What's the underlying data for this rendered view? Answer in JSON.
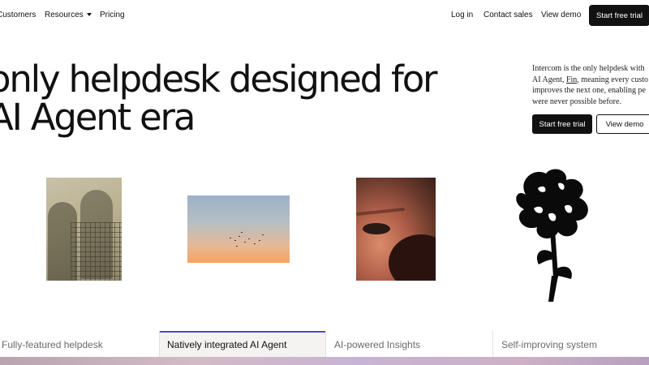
{
  "nav": {
    "customers": "Customers",
    "resources": "Resources",
    "pricing": "Pricing",
    "login": "Log in",
    "contact_sales": "Contact sales",
    "view_demo": "View demo",
    "start_trial": "Start free trial"
  },
  "hero": {
    "line1": "only helpdesk designed for",
    "line2": "AI Agent era",
    "desc_line1": "Intercom is the only helpdesk with",
    "desc_line2a": "AI Agent,",
    "desc_link": "Fin",
    "desc_line2b": ", meaning every custo",
    "desc_line3": "improves the next one, enabling pe",
    "desc_line4": "were never possible before.",
    "cta_primary": "Start free trial",
    "cta_secondary": "View demo"
  },
  "tabs": [
    {
      "label": "Fully-featured helpdesk",
      "active": false
    },
    {
      "label": "Natively integrated AI Agent",
      "active": true
    },
    {
      "label": "AI-powered Insights",
      "active": false
    },
    {
      "label": "Self-improving system",
      "active": false
    }
  ],
  "colors": {
    "primary": "#111111",
    "tab_accent": "#4f46e5",
    "background": "#ffffff"
  }
}
